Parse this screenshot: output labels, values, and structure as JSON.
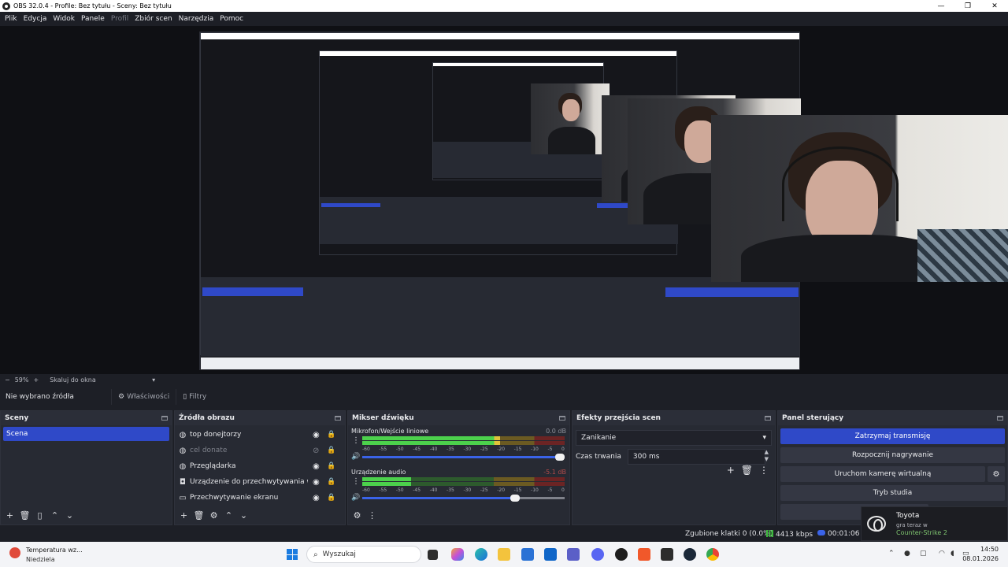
{
  "window": {
    "title": "OBS 32.0.4 - Profile: Bez tytułu - Sceny: Bez tytułu",
    "controls": [
      "—",
      "❐",
      "✕"
    ]
  },
  "menu": [
    {
      "label": "Plik",
      "disabled": false
    },
    {
      "label": "Edycja",
      "disabled": false
    },
    {
      "label": "Widok",
      "disabled": false
    },
    {
      "label": "Panele",
      "disabled": false
    },
    {
      "label": "Profil",
      "disabled": true
    },
    {
      "label": "Zbiór scen",
      "disabled": false
    },
    {
      "label": "Narzędzia",
      "disabled": false
    },
    {
      "label": "Pomoc",
      "disabled": false
    }
  ],
  "zoom": {
    "minus": "−",
    "percent": "59%",
    "plus": "+",
    "mode": "Skaluj do okna"
  },
  "source_toolbar": {
    "no_source": "Nie wybrano źródła",
    "properties": "Właściwości",
    "filters": "Filtry"
  },
  "scenes": {
    "header": "Sceny",
    "items": [
      "Scena"
    ]
  },
  "sources": {
    "header": "Źródła obrazu",
    "items": [
      {
        "name": "top donejtorzy",
        "icon": "globe-icon",
        "visible": true
      },
      {
        "name": "cel donate",
        "icon": "globe-icon",
        "visible": false
      },
      {
        "name": "Przeglądarka",
        "icon": "globe-icon",
        "visible": true
      },
      {
        "name": "Urządzenie do przechwytywania wideo",
        "icon": "camera-icon",
        "visible": true
      },
      {
        "name": "Przechwytywanie ekranu",
        "icon": "monitor-icon",
        "visible": true
      }
    ]
  },
  "mixer": {
    "header": "Mikser dźwięku",
    "scale": [
      "-60",
      "-55",
      "-50",
      "-45",
      "-40",
      "-35",
      "-30",
      "-25",
      "-20",
      "-15",
      "-10",
      "-5",
      "0"
    ],
    "channels": [
      {
        "name": "Mikrofon/Wejście liniowe",
        "db": "0.0 dB",
        "level": 0.68,
        "volume": 1.0
      },
      {
        "name": "Urządzenie audio",
        "db": "-5.1 dB",
        "level": 0.24,
        "volume": 0.78
      }
    ]
  },
  "transitions": {
    "header": "Efekty przejścia scen",
    "selected": "Zanikanie",
    "duration_label": "Czas trwania",
    "duration_value": "300 ms"
  },
  "controls": {
    "header": "Panel sterujący",
    "stop_stream": "Zatrzymaj transmisję",
    "start_record": "Rozpocznij nagrywanie",
    "virtual_cam": "Uruchom kamerę wirtualną",
    "studio_mode": "Tryb studia"
  },
  "status": {
    "dropped": "Zgubione klatki 0 (0.0%)",
    "bitrate": "4413 kbps",
    "time": "00:01:06"
  },
  "notification": {
    "title": "Toyota",
    "subtitle": "gra teraz w",
    "game": "Counter-Strike 2"
  },
  "taskbar": {
    "weather_title": "Temperatura wz...",
    "weather_sub": "Niedziela",
    "search_placeholder": "Wyszukaj",
    "time": "14:50",
    "date": "08.01.2026"
  },
  "colors": {
    "accent": "#2f49c8",
    "background": "#1d1f26",
    "dock": "#272a33"
  }
}
